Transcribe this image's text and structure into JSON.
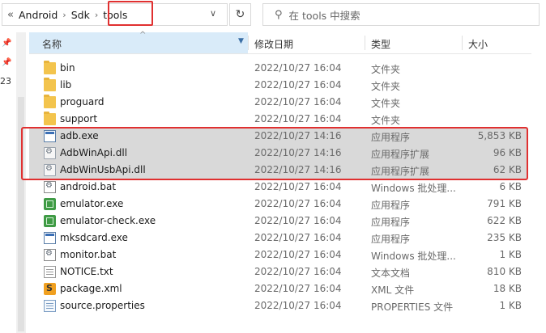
{
  "address": {
    "prefix": "«",
    "crumbs": [
      "Android",
      "Sdk",
      "tools"
    ],
    "refresh_icon": "↻",
    "dropdown_icon": "∨"
  },
  "search": {
    "placeholder": "在 tools 中搜索",
    "icon": "⚲"
  },
  "left_stub": "23",
  "columns": {
    "name": "名称",
    "date": "修改日期",
    "type": "类型",
    "size": "大小"
  },
  "files": [
    {
      "name": "bin",
      "date": "2022/10/27 16:04",
      "type": "文件夹",
      "size": "",
      "icon": "folder-icon"
    },
    {
      "name": "lib",
      "date": "2022/10/27 16:04",
      "type": "文件夹",
      "size": "",
      "icon": "folder-icon"
    },
    {
      "name": "proguard",
      "date": "2022/10/27 16:04",
      "type": "文件夹",
      "size": "",
      "icon": "folder-icon"
    },
    {
      "name": "support",
      "date": "2022/10/27 16:04",
      "type": "文件夹",
      "size": "",
      "icon": "folder-icon"
    },
    {
      "name": "adb.exe",
      "date": "2022/10/27 14:16",
      "type": "应用程序",
      "size": "5,853 KB",
      "icon": "exe-icon",
      "selected": true
    },
    {
      "name": "AdbWinApi.dll",
      "date": "2022/10/27 14:16",
      "type": "应用程序扩展",
      "size": "96 KB",
      "icon": "dll-icon",
      "selected": true
    },
    {
      "name": "AdbWinUsbApi.dll",
      "date": "2022/10/27 14:16",
      "type": "应用程序扩展",
      "size": "62 KB",
      "icon": "dll-icon",
      "selected": true
    },
    {
      "name": "android.bat",
      "date": "2022/10/27 16:04",
      "type": "Windows 批处理...",
      "size": "6 KB",
      "icon": "bat-icon"
    },
    {
      "name": "emulator.exe",
      "date": "2022/10/27 16:04",
      "type": "应用程序",
      "size": "791 KB",
      "icon": "emulator-icon"
    },
    {
      "name": "emulator-check.exe",
      "date": "2022/10/27 16:04",
      "type": "应用程序",
      "size": "622 KB",
      "icon": "emulator-icon"
    },
    {
      "name": "mksdcard.exe",
      "date": "2022/10/27 16:04",
      "type": "应用程序",
      "size": "235 KB",
      "icon": "exe-icon"
    },
    {
      "name": "monitor.bat",
      "date": "2022/10/27 16:04",
      "type": "Windows 批处理...",
      "size": "1 KB",
      "icon": "bat-icon"
    },
    {
      "name": "NOTICE.txt",
      "date": "2022/10/27 16:04",
      "type": "文本文档",
      "size": "810 KB",
      "icon": "text-file-icon"
    },
    {
      "name": "package.xml",
      "date": "2022/10/27 16:04",
      "type": "XML 文件",
      "size": "18 KB",
      "icon": "xml-file-icon"
    },
    {
      "name": "source.properties",
      "date": "2022/10/27 16:04",
      "type": "PROPERTIES 文件",
      "size": "1 KB",
      "icon": "properties-file-icon"
    }
  ],
  "colors": {
    "highlight": "#e03030",
    "selection": "#d9d9d9",
    "header_active": "#d9ebf9"
  }
}
